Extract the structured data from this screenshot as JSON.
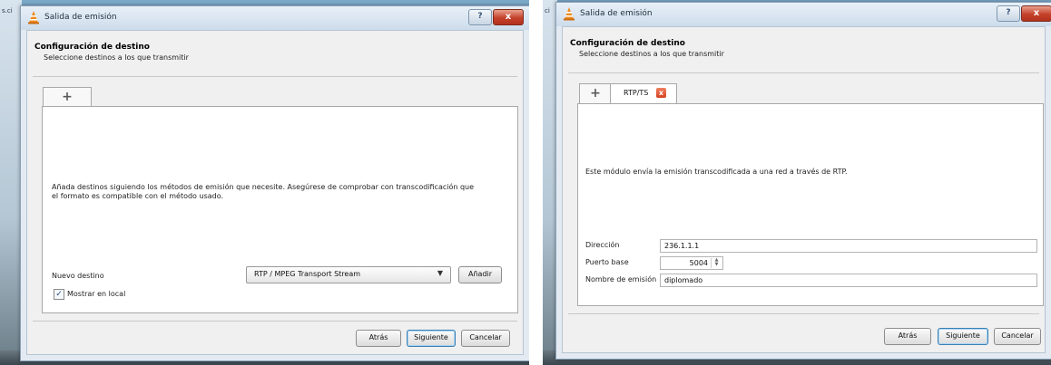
{
  "left": {
    "desktop_text": "s.ci",
    "window_title": "Salida de emisión",
    "help_button": "?",
    "close_button": "x",
    "header_title": "Configuración de destino",
    "header_subtitle": "Seleccione destinos a los que transmitir",
    "add_tab": "+",
    "description": "Añada destinos siguiendo los métodos de emisión que necesite. Asegúrese de comprobar con transcodificación que el formato es compatible con el método usado.",
    "new_dest_label": "Nuevo destino",
    "dest_combo_value": "RTP / MPEG Transport Stream",
    "combo_arrow": "▼",
    "add_button": "Añadir",
    "show_local_label": "Mostrar en local",
    "show_local_checked": "✓",
    "back_button": "Atrás",
    "next_button": "Siguiente",
    "cancel_button": "Cancelar"
  },
  "right": {
    "desktop_text": "ci",
    "window_title": "Salida de emisión",
    "help_button": "?",
    "close_button": "x",
    "header_title": "Configuración de destino",
    "header_subtitle": "Seleccione destinos a los que transmitir",
    "add_tab": "+",
    "rtp_tab_label": "RTP/TS",
    "rtp_tab_close": "x",
    "description": "Este módulo envía la emisión transcodificada a una red a través de RTP.",
    "address_label": "Dirección",
    "address_value": "236.1.1.1",
    "port_label": "Puerto base",
    "port_value": "5004",
    "stream_name_label": "Nombre de emisión",
    "stream_name_value": "diplomado",
    "back_button": "Atrás",
    "next_button": "Siguiente",
    "cancel_button": "Cancelar"
  },
  "colors": {
    "title_bar": "#cddceb",
    "close_red": "#c4412a",
    "default_button_border": "#3c7fb1"
  },
  "icons": {
    "app": "vlc-cone-icon",
    "add": "plus-icon",
    "dropdown": "chevron-down-icon",
    "check": "checkmark-icon"
  }
}
